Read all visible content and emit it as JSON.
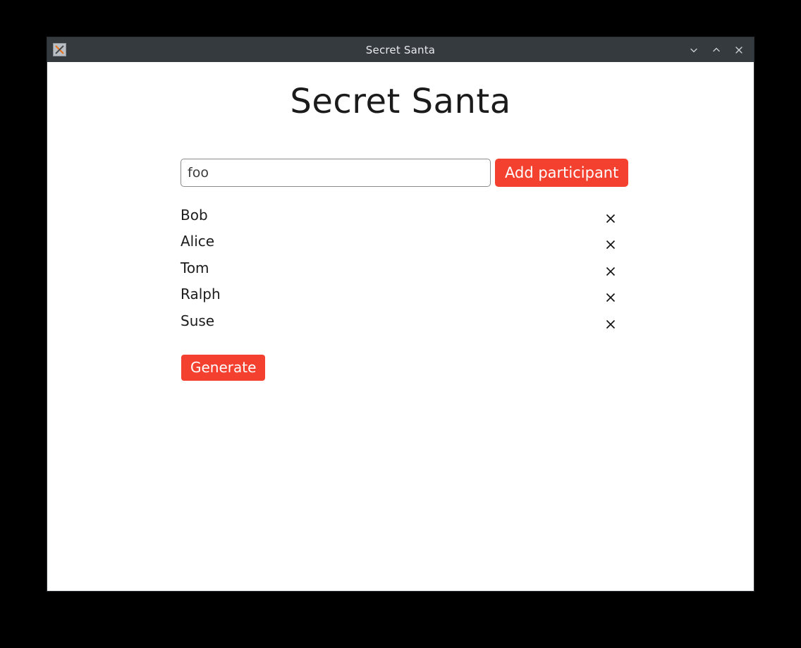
{
  "window": {
    "title": "Secret Santa",
    "app_icon": "x-logo-icon",
    "controls": [
      {
        "name": "minimize-button",
        "icon": "chevron-down-icon"
      },
      {
        "name": "maximize-button",
        "icon": "chevron-up-icon"
      },
      {
        "name": "close-button",
        "icon": "close-icon"
      }
    ]
  },
  "page": {
    "heading": "Secret Santa"
  },
  "add_row": {
    "input_value": "foo",
    "input_placeholder": "",
    "add_button_label": "Add participant"
  },
  "participants": [
    {
      "name": "Bob",
      "remove_icon": "close-icon"
    },
    {
      "name": "Alice",
      "remove_icon": "close-icon"
    },
    {
      "name": "Tom",
      "remove_icon": "close-icon"
    },
    {
      "name": "Ralph",
      "remove_icon": "close-icon"
    },
    {
      "name": "Suse",
      "remove_icon": "close-icon"
    }
  ],
  "actions": {
    "generate_label": "Generate"
  },
  "colors": {
    "accent_red": "#f4402f",
    "titlebar": "#343a3e",
    "desktop": "#000000",
    "content_bg": "#ffffff",
    "text": "#1c1c1c"
  }
}
